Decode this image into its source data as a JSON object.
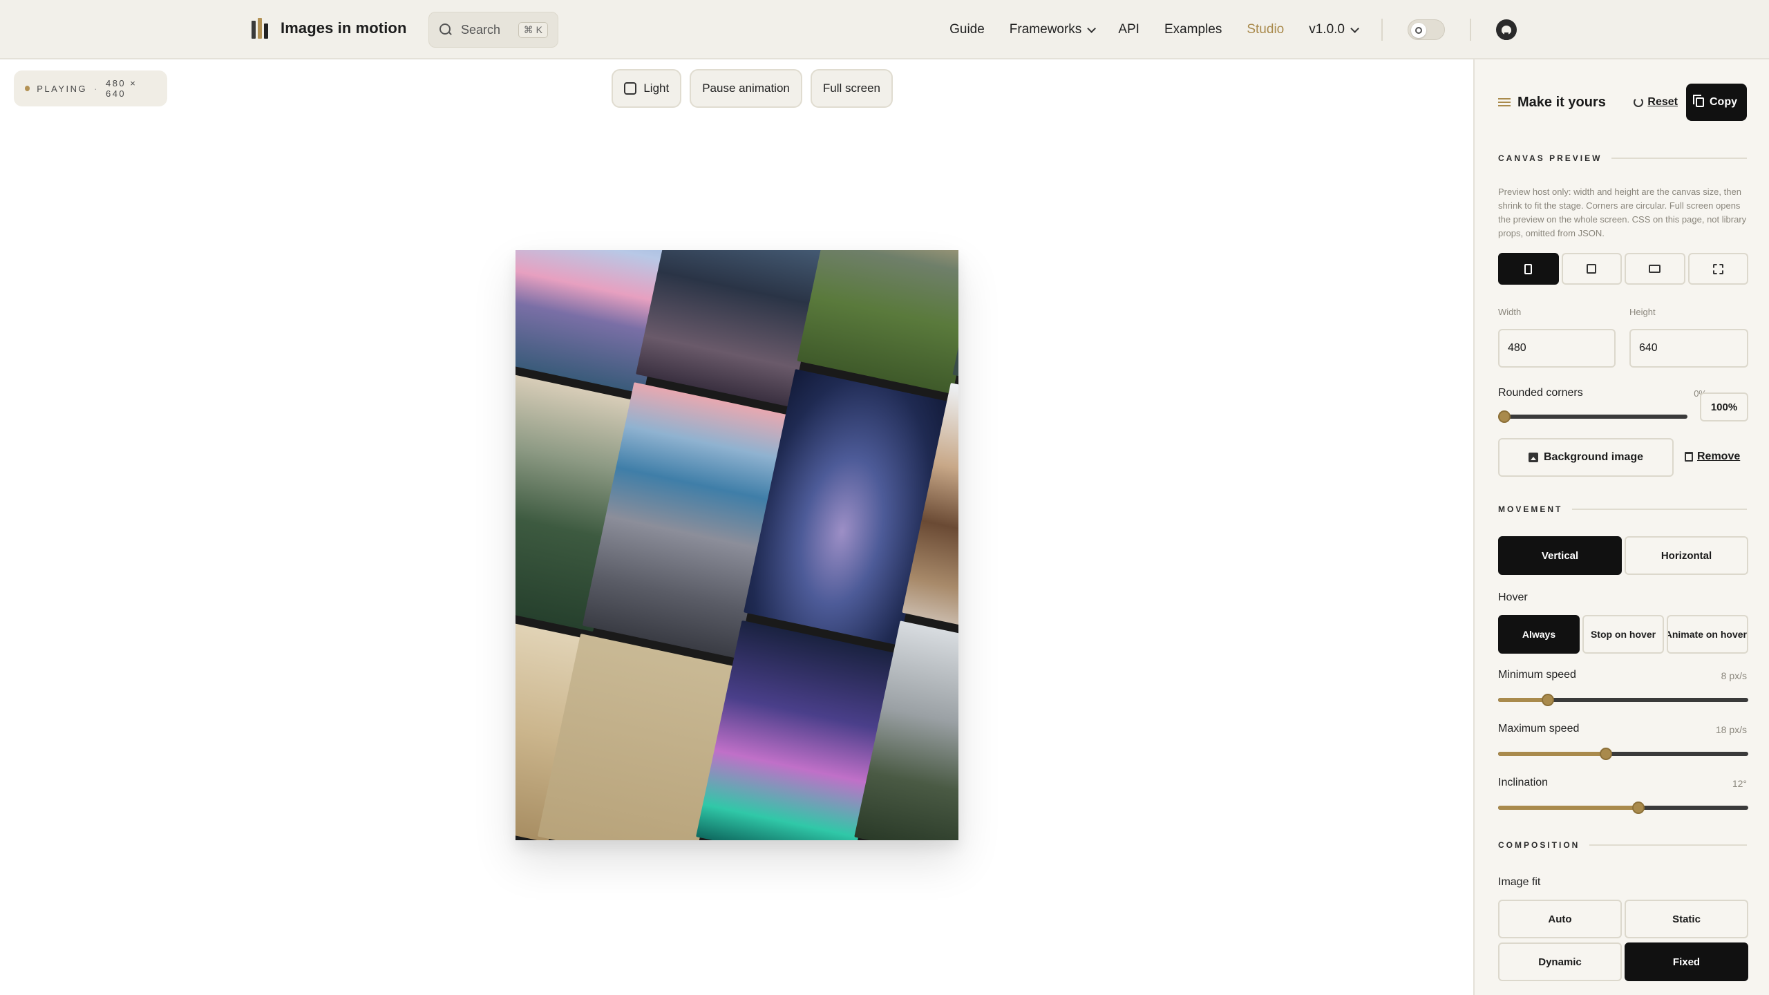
{
  "brand": {
    "title": "Images in motion"
  },
  "search": {
    "label": "Search",
    "shortcut": "⌘ K"
  },
  "nav": {
    "items": [
      "Guide",
      "Frameworks",
      "API",
      "Examples",
      "Studio"
    ],
    "version": "v1.0.0",
    "active": "Studio"
  },
  "stage": {
    "status": "PLAYING",
    "size": "480 × 640",
    "actions": {
      "light": "Light",
      "pause": "Pause animation",
      "fullscreen": "Full screen"
    }
  },
  "panel": {
    "title": "Make it yours",
    "reset": "Reset",
    "copy": "Copy",
    "canvas_section": "CANVAS PREVIEW",
    "hint": "Preview host only: width and height are the canvas size, then shrink to fit the stage. Corners are circular. Full screen opens the preview on the whole screen. CSS on this page, not library props, omitted from JSON.",
    "width_label": "Width",
    "width_value": "480",
    "height_label": "Height",
    "height_value": "640",
    "rounded_label": "Rounded corners",
    "rounded_value": "0%",
    "rounded_max": "100%",
    "bg_button": "Background image",
    "remove": "Remove",
    "movement_section": "MOVEMENT",
    "direction": {
      "vertical": "Vertical",
      "horizontal": "Horizontal",
      "selected": "Vertical"
    },
    "hover_label": "Hover",
    "hover": {
      "always": "Always",
      "stop": "Stop on hover",
      "animate": "Animate on hover",
      "selected": "Always"
    },
    "min_speed_label": "Minimum speed",
    "min_speed_value": "8 px/s",
    "max_speed_label": "Maximum speed",
    "max_speed_value": "18 px/s",
    "inclination_label": "Inclination",
    "inclination_value": "12°",
    "composition_section": "COMPOSITION",
    "image_fit_label": "Image fit",
    "fit": {
      "auto": "Auto",
      "static": "Static",
      "dynamic": "Dynamic",
      "fixed": "Fixed",
      "selected": "Fixed"
    }
  },
  "controls": {
    "rounded_corners_pct": 0,
    "min_speed_fraction": 0.2,
    "max_speed_fraction": 0.43,
    "inclination_fraction": 0.56
  },
  "colors": {
    "accent": "#a98a4c",
    "dark": "#111111",
    "topbar": "#f2f0ea",
    "panel": "#f7f5f0"
  },
  "icons": [
    "brand-logo-icon",
    "search-icon",
    "chevron-down-icon",
    "sun-icon",
    "github-icon",
    "checkbox-icon",
    "sliders-icon",
    "reset-icon",
    "copy-icon",
    "portrait-icon",
    "square-icon",
    "landscape-icon",
    "fullscreen-icon",
    "image-icon",
    "trash-icon"
  ]
}
